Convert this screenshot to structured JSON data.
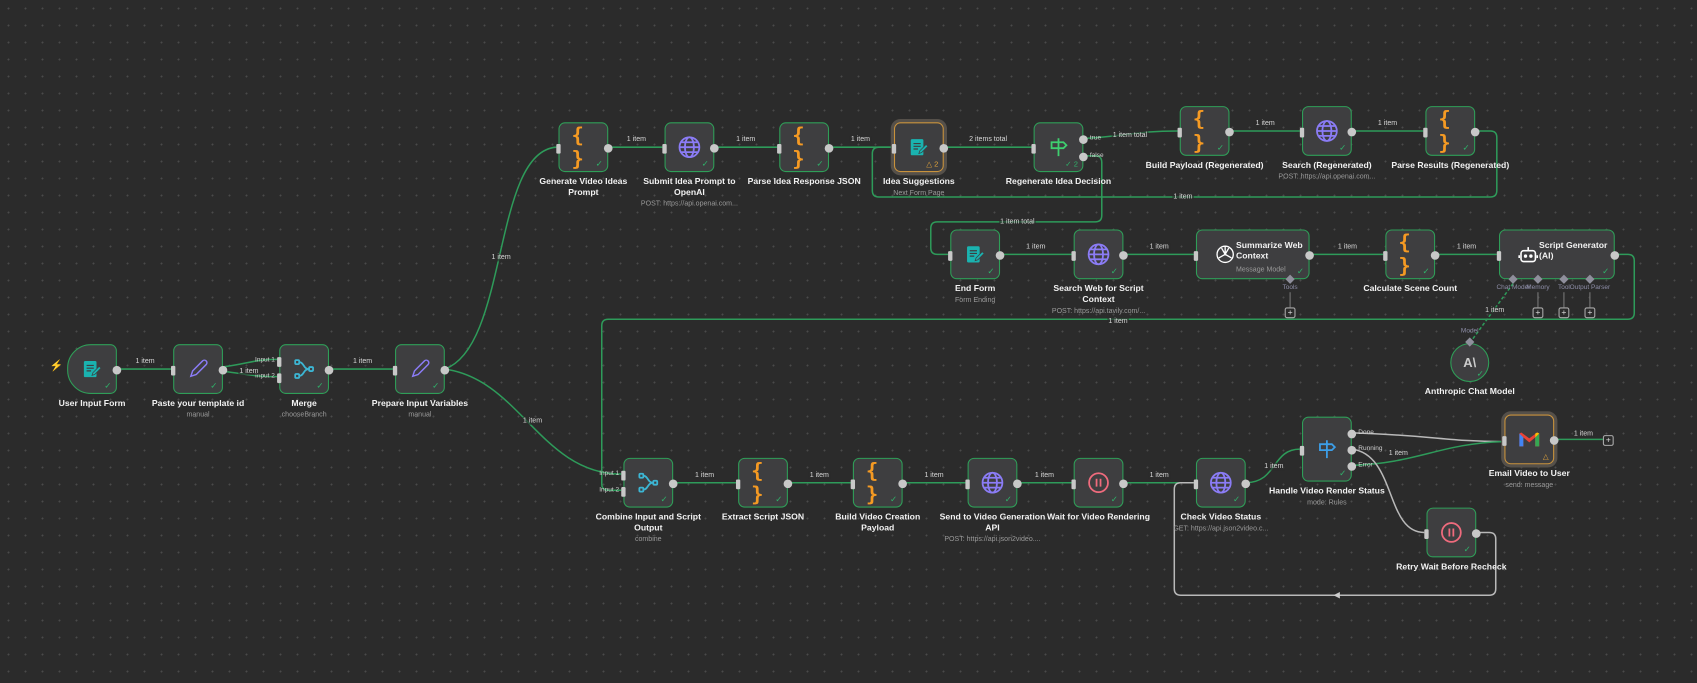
{
  "canvas": {
    "accent_success": "#2f9e58",
    "accent_warning": "#c9923c",
    "background": "#2b2b2b"
  },
  "nodes": [
    {
      "label": "User Input Form",
      "icon": "form-icon"
    },
    {
      "label": "Paste your template id",
      "sub": "manual",
      "icon": "pencil-icon"
    },
    {
      "label": "Merge",
      "sub": "chooseBranch",
      "icon": "merge-icon",
      "inputs": [
        "Input 1",
        "Input 2"
      ]
    },
    {
      "label": "Prepare Input Variables",
      "sub": "manual",
      "icon": "pencil-icon"
    },
    {
      "label": "Generate Video Ideas Prompt",
      "icon": "code-braces-icon"
    },
    {
      "label": "Submit Idea Prompt to OpenAI",
      "sub": "POST: https://api.openai.com...",
      "icon": "globe-icon"
    },
    {
      "label": "Parse Idea Response JSON",
      "icon": "code-braces-icon"
    },
    {
      "label": "Idea Suggestions",
      "sub": "Next Form Page",
      "icon": "form-icon",
      "badge": "△ 2"
    },
    {
      "label": "Regenerate Idea Decision",
      "icon": "signpost-icon",
      "badge": "✓ 2",
      "outputs": [
        "true",
        "false"
      ]
    },
    {
      "label": "Build Payload (Regenerated)",
      "icon": "code-braces-icon"
    },
    {
      "label": "Search (Regenerated)",
      "sub": "POST: https://api.openai.com...",
      "icon": "globe-icon"
    },
    {
      "label": "Parse Results (Regenerated)",
      "icon": "code-braces-icon"
    },
    {
      "label": "End Form",
      "sub": "Form Ending",
      "icon": "form-icon"
    },
    {
      "label": "Search Web for Script Context",
      "sub": "POST: https://api.tavily.com/...",
      "icon": "globe-icon"
    },
    {
      "label": "Summarize Web Context",
      "sub": "Message Model",
      "icon": "openai-icon",
      "subports": [
        "Tools"
      ]
    },
    {
      "label": "Calculate Scene Count",
      "icon": "code-braces-icon"
    },
    {
      "label": "Script Generator (AI)",
      "icon": "robot-icon",
      "subports": [
        "Chat Model",
        "Memory",
        "Tool",
        "Output Parser"
      ]
    },
    {
      "label": "Anthropic Chat Model",
      "icon": "anthropic-icon",
      "glyph": "A\\",
      "port": "Model"
    },
    {
      "label": "Combine Input and Script Output",
      "sub": "combine",
      "icon": "merge-icon",
      "inputs": [
        "Input 1",
        "Input 2"
      ]
    },
    {
      "label": "Extract Script JSON",
      "icon": "code-braces-icon"
    },
    {
      "label": "Build Video Creation Payload",
      "icon": "code-braces-icon"
    },
    {
      "label": "Send to Video Generation API",
      "sub": "POST: https://api.json2video....",
      "icon": "globe-icon"
    },
    {
      "label": "Wait for Video Rendering",
      "icon": "pause-icon"
    },
    {
      "label": "Check Video Status",
      "sub": "GET: https://api.json2video.c...",
      "icon": "globe-icon"
    },
    {
      "label": "Handle Video Render Status",
      "sub": "mode: Rules",
      "icon": "signpost-icon",
      "outputs": [
        "Done",
        "Running",
        "Error"
      ]
    },
    {
      "label": "Email Video to User",
      "sub": "send: message",
      "icon": "gmail-icon",
      "badge": "△"
    },
    {
      "label": "Retry Wait Before Recheck",
      "icon": "pause-icon"
    }
  ],
  "edges": [
    {
      "label": "1 item"
    },
    {
      "label": ""
    },
    {
      "label": "1 item"
    },
    {
      "label": "1 item"
    },
    {
      "label": "1 item"
    },
    {
      "label": "1 item"
    },
    {
      "label": "1 item"
    },
    {
      "label": "1 item"
    },
    {
      "label": "1 item"
    },
    {
      "label": "2 items total"
    },
    {
      "label": "1 item total"
    },
    {
      "label": "1 item"
    },
    {
      "label": "1 item"
    },
    {
      "label": "1 item"
    },
    {
      "label": "1 item total"
    },
    {
      "label": "1 item"
    },
    {
      "label": "1 item"
    },
    {
      "label": "1 item"
    },
    {
      "label": "1 item"
    },
    {
      "label": "1 item"
    },
    {
      "label": "1 item"
    },
    {
      "label": "1 item"
    },
    {
      "label": "1 item"
    },
    {
      "label": "1 item"
    },
    {
      "label": "1 item"
    },
    {
      "label": "1 item"
    },
    {
      "label": "1 item"
    },
    {
      "label": ""
    },
    {
      "label": "1 item"
    },
    {
      "label": ""
    },
    {
      "label": ""
    },
    {
      "label": "1 item"
    }
  ]
}
